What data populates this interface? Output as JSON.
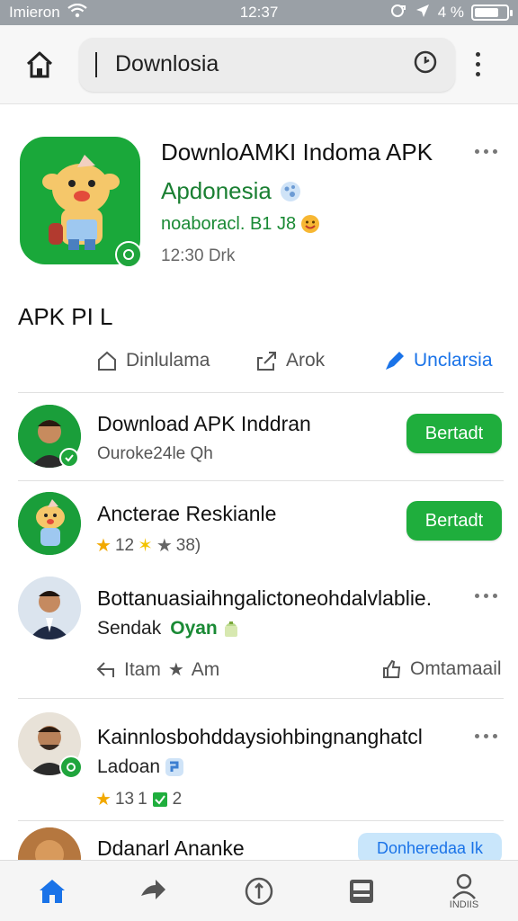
{
  "status_bar": {
    "carrier": "Imieron",
    "time": "12:37",
    "battery_label": "4 %",
    "battery_level": 0.75
  },
  "search": {
    "query": "Downlosia"
  },
  "hero": {
    "title": "DownloAMKI Indoma APK",
    "subtitle": "Apdonesia",
    "publisher": "noaboracl. B1 J8",
    "time": "12:30 Drk"
  },
  "section": {
    "title": "APK PI L"
  },
  "actions": [
    {
      "label": "Dinlulama",
      "icon": "bookmark-icon"
    },
    {
      "label": "Arok",
      "icon": "share-icon"
    },
    {
      "label": "Unclarsia",
      "icon": "edit-icon"
    }
  ],
  "items": [
    {
      "title": "Download APK Inddran",
      "subtitle": "Ouroke24le Qh",
      "button": "Bertadt"
    },
    {
      "title": "Ancterae Reskianle",
      "rating_text": "12",
      "rating_text_2": "38)",
      "button": "Bertadt"
    },
    {
      "title": "Bottanuasiaihngalictoneohdalvlablie.",
      "subtitle_prefix": "Sendak",
      "subtitle_highlight": "Oyan",
      "action_left_1": "Itam",
      "action_left_2": "Am",
      "action_right": "Omtamaail"
    },
    {
      "title": "Kainnlosbohddaysiohbingnanghatcl",
      "subtitle": "Ladoan",
      "rating_text": "13",
      "rating_text_2": "1",
      "rating_text_3": "2"
    },
    {
      "title": "Ddanarl Ananke",
      "button": "Donheredaa Ik"
    }
  ],
  "bottom_nav": {
    "items": [
      {
        "icon": "home-icon",
        "label": ""
      },
      {
        "icon": "arrow-icon",
        "label": ""
      },
      {
        "icon": "info-icon",
        "label": ""
      },
      {
        "icon": "save-icon",
        "label": ""
      },
      {
        "icon": "profile-icon",
        "label": "INDIIS"
      }
    ]
  },
  "colors": {
    "accent": "#1fae3d",
    "blue": "#1a73e8",
    "status_bar": "#9aa0a6"
  }
}
